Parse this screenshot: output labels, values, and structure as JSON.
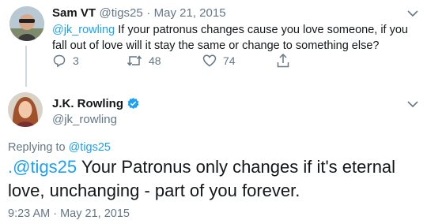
{
  "colors": {
    "link": "#1da1f2",
    "muted": "#657786",
    "text": "#14171a",
    "verified": "#1da1f2",
    "thread_line": "#cfd9de"
  },
  "reply_tweet": {
    "display_name": "Sam VT",
    "handle": "@tigs25",
    "separator": "·",
    "date": "May 21, 2015",
    "mention": "@jk_rowling",
    "text": " If your patronus changes cause you love someone, if you fall out of love will it stay the same or change to something else?",
    "actions": {
      "reply_icon": "reply-icon",
      "reply_count": "3",
      "retweet_icon": "retweet-icon",
      "retweet_count": "48",
      "like_icon": "heart-icon",
      "like_count": "74",
      "share_icon": "share-icon"
    }
  },
  "main_tweet": {
    "display_name": "J.K. Rowling",
    "verified_icon": "verified-badge-icon",
    "handle": "@jk_rowling",
    "replying_to_label": "Replying to",
    "replying_to_handle": "@tigs25",
    "mention": ".@tigs25",
    "text": " Your Patronus only changes if it's eternal love, unchanging - part of you forever.",
    "timestamp": "9:23 AM · May 21, 2015"
  }
}
